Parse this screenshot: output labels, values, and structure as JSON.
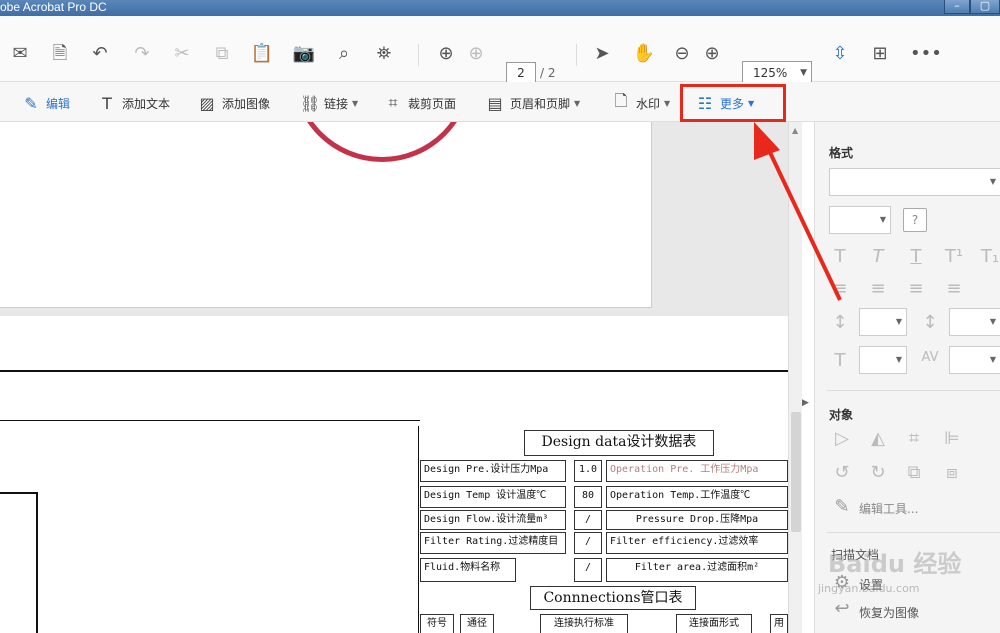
{
  "window": {
    "title": "obe Acrobat Pro DC",
    "min_label": "–",
    "max_label": "▢"
  },
  "toolbar": {
    "page_current": "2",
    "page_total": "/ 2",
    "zoom": "125%"
  },
  "editbar": {
    "edit": "编辑",
    "add_text": "添加文本",
    "add_image": "添加图像",
    "link": "链接",
    "crop": "裁剪页面",
    "header_footer": "页眉和页脚",
    "watermark": "水印",
    "more": "更多"
  },
  "panel": {
    "format_label": "格式",
    "object_label": "对象",
    "edit_tool": "编辑工具...",
    "scan_doc": "扫描文档",
    "settings": "设置",
    "restore_image": "恢复为图像"
  },
  "document": {
    "table_title": "Design data设计数据表",
    "rows": [
      {
        "l": "Design Pre.设计压力Mpa",
        "v": "1.0",
        "r": "Operation Pre. 工作压力Mpa"
      },
      {
        "l": "Design Temp 设计温度℃",
        "v": "80",
        "r": "Operation Temp.工作温度℃"
      },
      {
        "l": "Design Flow.设计流量m³",
        "v": "/",
        "r": "Pressure Drop.压降Mpa"
      },
      {
        "l": "Filter Rating.过滤精度目",
        "v": "/",
        "r": "Filter efficiency.过滤效率"
      },
      {
        "l": "Fluid.物料名称",
        "v": "/",
        "r": "Filter area.过滤面积m²"
      }
    ],
    "connections_title": "Connnections管口表",
    "headers": [
      "符号",
      "通径",
      "连接执行标准",
      "连接面形式",
      "用"
    ]
  },
  "watermark": {
    "brand": "Baidu 经验",
    "url": "jingyan.baidu.com"
  },
  "colors": {
    "accent": "#2a73d0",
    "highlight": "#e8281c",
    "stamp": "#c4324a"
  }
}
